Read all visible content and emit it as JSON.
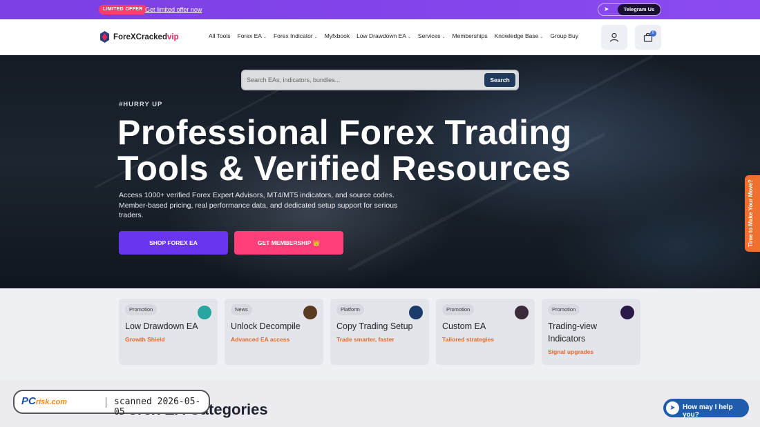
{
  "promo": {
    "badge": "LIMITED OFFER",
    "link": "Get limited offer now",
    "telegram_label": "Telegram Us"
  },
  "header": {
    "logo_text": "ForeXCracked",
    "logo_suffix": "vip",
    "nav": [
      {
        "label": "All Tools",
        "dropdown": false
      },
      {
        "label": "Forex EA",
        "dropdown": true
      },
      {
        "label": "Forex Indicator",
        "dropdown": true
      },
      {
        "label": "Myfxbook",
        "dropdown": false
      },
      {
        "label": "Low Drawdown EA",
        "dropdown": true
      },
      {
        "label": "Services",
        "dropdown": true
      },
      {
        "label": "Memberships",
        "dropdown": false
      },
      {
        "label": "Knowledge Base",
        "dropdown": true
      },
      {
        "label": "Group Buy",
        "dropdown": false
      }
    ],
    "cart_count": "0"
  },
  "hero": {
    "search_placeholder": "Search EAs, indicators, bundles...",
    "search_button": "Search",
    "eyebrow": "#HURRY UP",
    "title_line1": "Professional Forex Trading",
    "title_line2": "Tools & Verified Resources",
    "description": "Access 1000+ verified Forex Expert Advisors, MT4/MT5 indicators, and source codes. Member-based pricing, real performance data, and dedicated setup support for serious traders.",
    "btn_shop": "SHOP FOREX EA",
    "btn_membership": "GET MEMBERSHIP 👑",
    "side_tab": "Time to Make Your Move?"
  },
  "cards": [
    {
      "tag": "Promotion",
      "title": "Low Drawdown EA",
      "subtitle": "Growth Shield",
      "logo_color": "#2aa6a0"
    },
    {
      "tag": "News",
      "title": "Unlock Decompile",
      "subtitle": "Advanced EA access",
      "logo_color": "#5a3a20"
    },
    {
      "tag": "Platform",
      "title": "Copy Trading Setup",
      "subtitle": "Trade smarter, faster",
      "logo_color": "#1c3a6a"
    },
    {
      "tag": "Promotion",
      "title": "Custom EA",
      "subtitle": "Tailored strategies",
      "logo_color": "#3a2a3a"
    },
    {
      "tag": "Promotion",
      "title": "Trading-view Indicators",
      "subtitle": "Signal upgrades",
      "logo_color": "#2a1a4a"
    }
  ],
  "section": {
    "title": "Forex EA Categories"
  },
  "scan": {
    "logo_pc": "PC",
    "logo_risk": "risk.com",
    "text": "scanned 2026-05-05"
  },
  "chat": {
    "label": "How may I help you?"
  },
  "colors": {
    "accent_purple": "#6a35ee",
    "accent_pink": "#ff3f7a",
    "orange": "#f07030",
    "subtitle_orange": "#e06a2c"
  }
}
